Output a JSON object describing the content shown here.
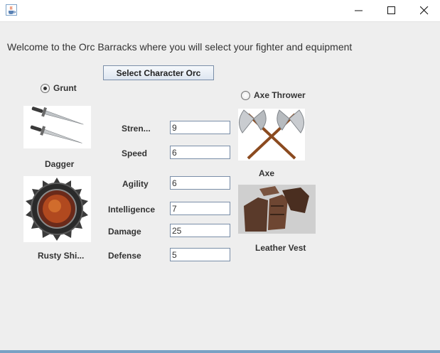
{
  "window": {
    "title": ""
  },
  "welcome_text": "Welcome to the Orc Barracks where you will select your fighter and equipment",
  "select_button_label": "Select Character Orc",
  "characters": {
    "grunt": {
      "label": "Grunt",
      "selected": true
    },
    "axe_thrower": {
      "label": "Axe Thrower",
      "selected": false
    }
  },
  "equipment": {
    "dagger_label": "Dagger",
    "shield_label": "Rusty Shi...",
    "axe_label": "Axe",
    "vest_label": "Leather Vest"
  },
  "stats": {
    "strength": {
      "label": "Stren...",
      "value": "9"
    },
    "speed": {
      "label": "Speed",
      "value": "6"
    },
    "agility": {
      "label": "Agility",
      "value": "6"
    },
    "intelligence": {
      "label": "Intelligence",
      "value": "7"
    },
    "damage": {
      "label": "Damage",
      "value": "25"
    },
    "defense": {
      "label": "Defense",
      "value": "5"
    }
  },
  "icons": {
    "app": "java-cup-icon",
    "minimize": "minimize-icon",
    "maximize": "maximize-icon",
    "close": "close-icon"
  }
}
